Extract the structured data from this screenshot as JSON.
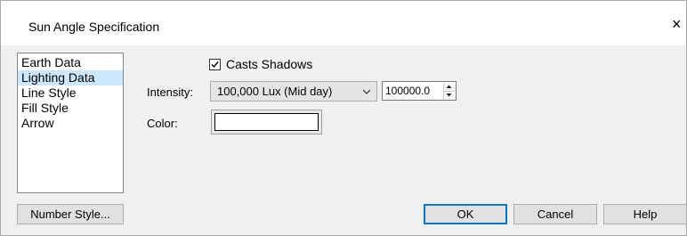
{
  "window": {
    "title": "Sun Angle Specification",
    "close_glyph": "×"
  },
  "panel_list": {
    "items": [
      "Earth Data",
      "Lighting Data",
      "Line Style",
      "Fill Style",
      "Arrow"
    ],
    "selected": "Lighting Data"
  },
  "lighting": {
    "casts_shadows_label": "Casts Shadows",
    "casts_shadows_checked": true,
    "intensity_label": "Intensity:",
    "intensity_option": "100,000 Lux (Mid day)",
    "intensity_value": "100000.0",
    "color_label": "Color:",
    "color_value": "#ffffff"
  },
  "buttons": {
    "number_style": "Number Style...",
    "ok": "OK",
    "cancel": "Cancel",
    "help": "Help"
  },
  "colors": {
    "selection": "#cce8ff",
    "default_button_border": "#0078d7"
  }
}
